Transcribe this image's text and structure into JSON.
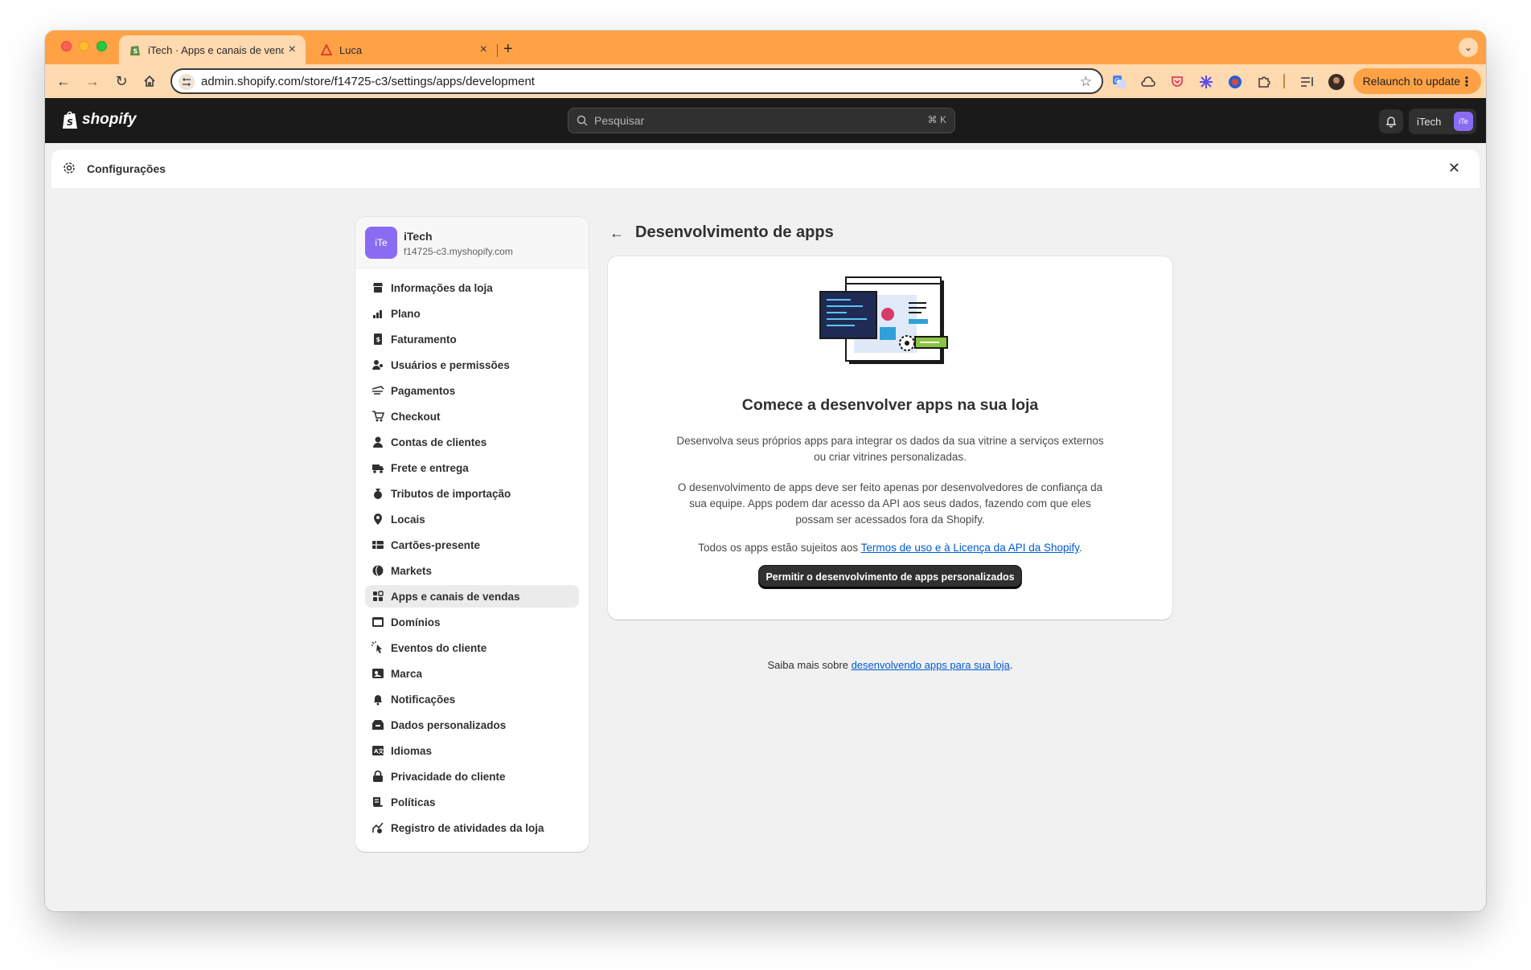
{
  "browser": {
    "tabs": [
      {
        "title": "iTech · Apps e canais de vend",
        "active": true
      },
      {
        "title": "Luca",
        "active": false
      }
    ],
    "url": "admin.shopify.com/store/f14725-c3/settings/apps/development",
    "relaunch_label": "Relaunch to update",
    "accent_color": "#ffa246"
  },
  "shopify": {
    "logo_text": "shopify",
    "search_placeholder": "Pesquisar",
    "search_shortcut": "⌘ K",
    "store_button_label": "iTech",
    "store_avatar": "iTe"
  },
  "settings": {
    "title": "Configurações",
    "store": {
      "avatar": "iTe",
      "name": "iTech",
      "domain": "f14725-c3.myshopify.com"
    },
    "menu": [
      {
        "label": "Informações da loja",
        "icon": "store-icon"
      },
      {
        "label": "Plano",
        "icon": "plan-icon"
      },
      {
        "label": "Faturamento",
        "icon": "billing-icon"
      },
      {
        "label": "Usuários e permissões",
        "icon": "users-icon"
      },
      {
        "label": "Pagamentos",
        "icon": "payments-icon"
      },
      {
        "label": "Checkout",
        "icon": "cart-icon"
      },
      {
        "label": "Contas de clientes",
        "icon": "person-icon"
      },
      {
        "label": "Frete e entrega",
        "icon": "truck-icon"
      },
      {
        "label": "Tributos de importação",
        "icon": "money-bag-icon"
      },
      {
        "label": "Locais",
        "icon": "location-icon"
      },
      {
        "label": "Cartões-presente",
        "icon": "gift-card-icon"
      },
      {
        "label": "Markets",
        "icon": "globe-icon"
      },
      {
        "label": "Apps e canais de vendas",
        "icon": "apps-icon",
        "selected": true
      },
      {
        "label": "Domínios",
        "icon": "domain-icon"
      },
      {
        "label": "Eventos do cliente",
        "icon": "cursor-icon"
      },
      {
        "label": "Marca",
        "icon": "brand-icon"
      },
      {
        "label": "Notificações",
        "icon": "bell-icon"
      },
      {
        "label": "Dados personalizados",
        "icon": "data-icon"
      },
      {
        "label": "Idiomas",
        "icon": "language-icon"
      },
      {
        "label": "Privacidade do cliente",
        "icon": "lock-icon"
      },
      {
        "label": "Políticas",
        "icon": "policy-icon"
      },
      {
        "label": "Registro de atividades da loja",
        "icon": "activity-icon"
      }
    ]
  },
  "main": {
    "title": "Desenvolvimento de apps",
    "card": {
      "heading": "Comece a desenvolver apps na sua loja",
      "p1": "Desenvolva seus próprios apps para integrar os dados da sua vitrine a serviços externos ou criar vitrines personalizadas.",
      "p2": "O desenvolvimento de apps deve ser feito apenas por desenvolvedores de confiança da sua equipe. Apps podem dar acesso da API aos seus dados, fazendo com que eles possam ser acessados fora da Shopify.",
      "p3_prefix": "Todos os apps estão sujeitos aos ",
      "p3_link": "Termos de uso e à Licença da API da Shopify",
      "p3_suffix": ".",
      "button_label": "Permitir o desenvolvimento de apps personalizados"
    },
    "footer_prefix": "Saiba mais sobre ",
    "footer_link": "desenvolvendo apps para sua loja",
    "footer_suffix": "."
  }
}
